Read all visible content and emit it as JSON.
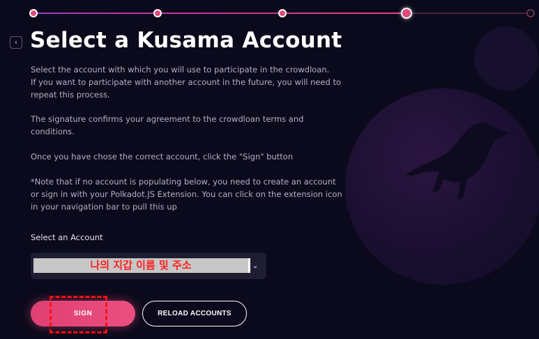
{
  "stepper": {
    "total_steps": 5,
    "current_step": 4,
    "colors": {
      "active": "#e04a7a",
      "future": "#6a3450"
    }
  },
  "header": {
    "back_icon": "chevron-left-icon",
    "title": "Select a Kusama Account"
  },
  "instructions": {
    "paragraph1": [
      "Select the account with which you will use to participate in the crowdloan.",
      "If you want to participate with another account in the future, you will need to",
      "repeat this process."
    ],
    "paragraph2": [
      "The signature confirms your agreement to the crowdloan terms and",
      "conditions."
    ],
    "paragraph3": [
      "Once you have chose the correct account, click the \"Sign\" button"
    ],
    "paragraph4": [
      "*Note that if no account is populating below, you need to create an account",
      "or sign in with your Polkadot.JS Extension. You can click on the extension icon",
      "in your navigation bar to pull this up"
    ]
  },
  "account": {
    "label": "Select an Account",
    "selected_value": "나의 지갑 이름 및 주소",
    "dropdown_icon": "chevron-down-icon"
  },
  "actions": {
    "sign_label": "SIGN",
    "reload_label": "RELOAD ACCOUNTS"
  },
  "colors": {
    "background": "#0b0a1c",
    "accent": "#e04073",
    "annotation": "#ff1010"
  }
}
